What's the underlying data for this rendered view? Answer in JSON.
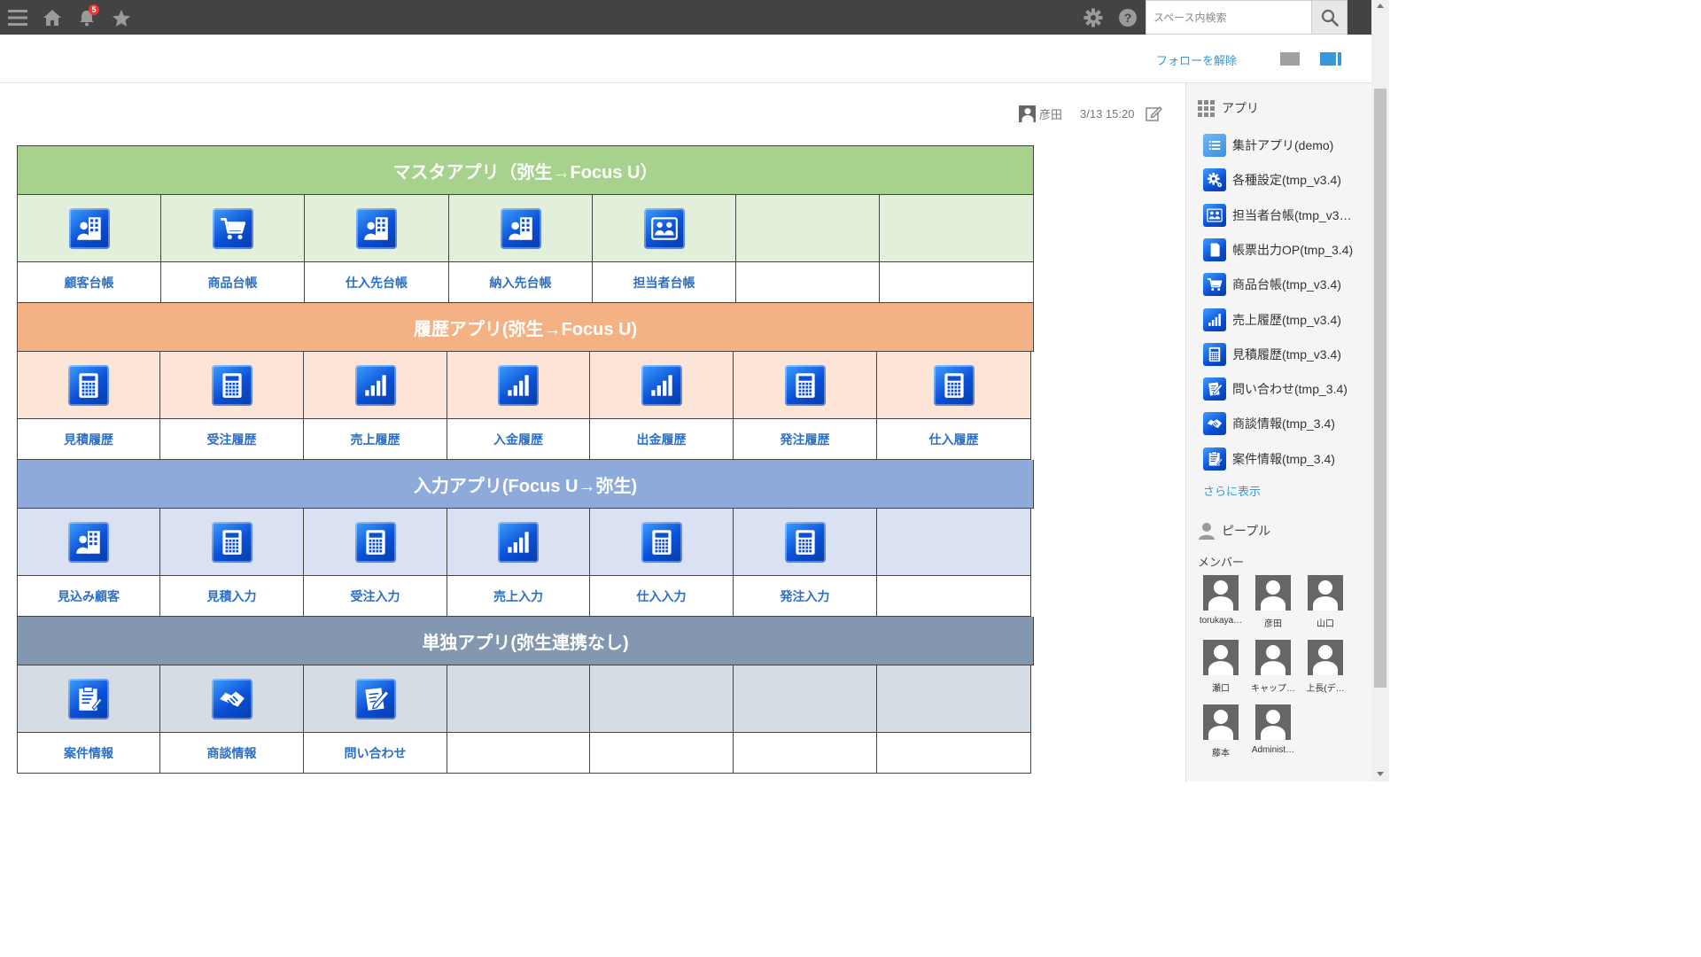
{
  "header": {
    "notification_count": "5",
    "search_placeholder": "スペース内検索",
    "icons": [
      "menu-icon",
      "home-icon",
      "bell-icon",
      "star-icon",
      "gear-icon",
      "help-icon",
      "search-icon"
    ]
  },
  "subheader": {
    "unfollow_label": "フォローを解除"
  },
  "post": {
    "author": "彦田",
    "date": "3/13 15:20"
  },
  "sections": [
    {
      "title": "マスタアプリ（弥生→Focus U）",
      "header_color": "#a7d28d",
      "body_color": "#e2efda",
      "apps": [
        {
          "label": "顧客台帳",
          "icon": "building-person-icon"
        },
        {
          "label": "商品台帳",
          "icon": "cart-icon"
        },
        {
          "label": "仕入先台帳",
          "icon": "building-person-icon"
        },
        {
          "label": "納入先台帳",
          "icon": "building-person-icon"
        },
        {
          "label": "担当者台帳",
          "icon": "people-icon"
        },
        {
          "label": "",
          "icon": ""
        },
        {
          "label": "",
          "icon": ""
        }
      ]
    },
    {
      "title": "履歴アプリ(弥生→Focus U)",
      "header_color": "#f4b183",
      "body_color": "#fce4d6",
      "apps": [
        {
          "label": "見積履歴",
          "icon": "calculator-icon"
        },
        {
          "label": "受注履歴",
          "icon": "calculator-icon"
        },
        {
          "label": "売上履歴",
          "icon": "bar-chart-icon"
        },
        {
          "label": "入金履歴",
          "icon": "bar-chart-icon"
        },
        {
          "label": "出金履歴",
          "icon": "bar-chart-icon"
        },
        {
          "label": "発注履歴",
          "icon": "calculator-icon"
        },
        {
          "label": "仕入履歴",
          "icon": "calculator-icon"
        }
      ]
    },
    {
      "title": "入力アプリ(Focus U→弥生)",
      "header_color": "#8eaadb",
      "body_color": "#d9e1f2",
      "apps": [
        {
          "label": "見込み顧客",
          "icon": "building-person-icon"
        },
        {
          "label": "見積入力",
          "icon": "calculator-icon"
        },
        {
          "label": "受注入力",
          "icon": "calculator-icon"
        },
        {
          "label": "売上入力",
          "icon": "bar-chart-icon"
        },
        {
          "label": "仕入入力",
          "icon": "calculator-icon"
        },
        {
          "label": "発注入力",
          "icon": "calculator-icon"
        },
        {
          "label": "",
          "icon": ""
        }
      ]
    },
    {
      "title": "単独アプリ(弥生連携なし)",
      "header_color": "#8497b0",
      "body_color": "#d6dce4",
      "apps": [
        {
          "label": "案件情報",
          "icon": "clipboard-icon"
        },
        {
          "label": "商談情報",
          "icon": "handshake-icon"
        },
        {
          "label": "問い合わせ",
          "icon": "document-pen-icon"
        },
        {
          "label": "",
          "icon": ""
        },
        {
          "label": "",
          "icon": ""
        },
        {
          "label": "",
          "icon": ""
        },
        {
          "label": "",
          "icon": ""
        }
      ]
    }
  ],
  "sidebar": {
    "apps_title": "アプリ",
    "apps": [
      {
        "label": "集計アプリ(demo)",
        "icon": "list-icon"
      },
      {
        "label": "各種設定(tmp_v3.4)",
        "icon": "gear-icon"
      },
      {
        "label": "担当者台帳(tmp_v3…",
        "icon": "people-icon"
      },
      {
        "label": "帳票出力OP(tmp_3.4)",
        "icon": "document-icon"
      },
      {
        "label": "商品台帳(tmp_v3.4)",
        "icon": "cart-icon"
      },
      {
        "label": "売上履歴(tmp_v3.4)",
        "icon": "bar-chart-icon"
      },
      {
        "label": "見積履歴(tmp_v3.4)",
        "icon": "calculator-icon"
      },
      {
        "label": "問い合わせ(tmp_3.4)",
        "icon": "document-pen-icon"
      },
      {
        "label": "商談情報(tmp_3.4)",
        "icon": "handshake-icon"
      },
      {
        "label": "案件情報(tmp_3.4)",
        "icon": "clipboard-icon"
      }
    ],
    "more_label": "さらに表示",
    "people_title": "ピープル",
    "members_label": "メンバー",
    "members": [
      "torukaya…",
      "彦田",
      "山口",
      "瀬口",
      "キャップ…",
      "上長(デ…",
      "藤本",
      "Administ…"
    ]
  }
}
